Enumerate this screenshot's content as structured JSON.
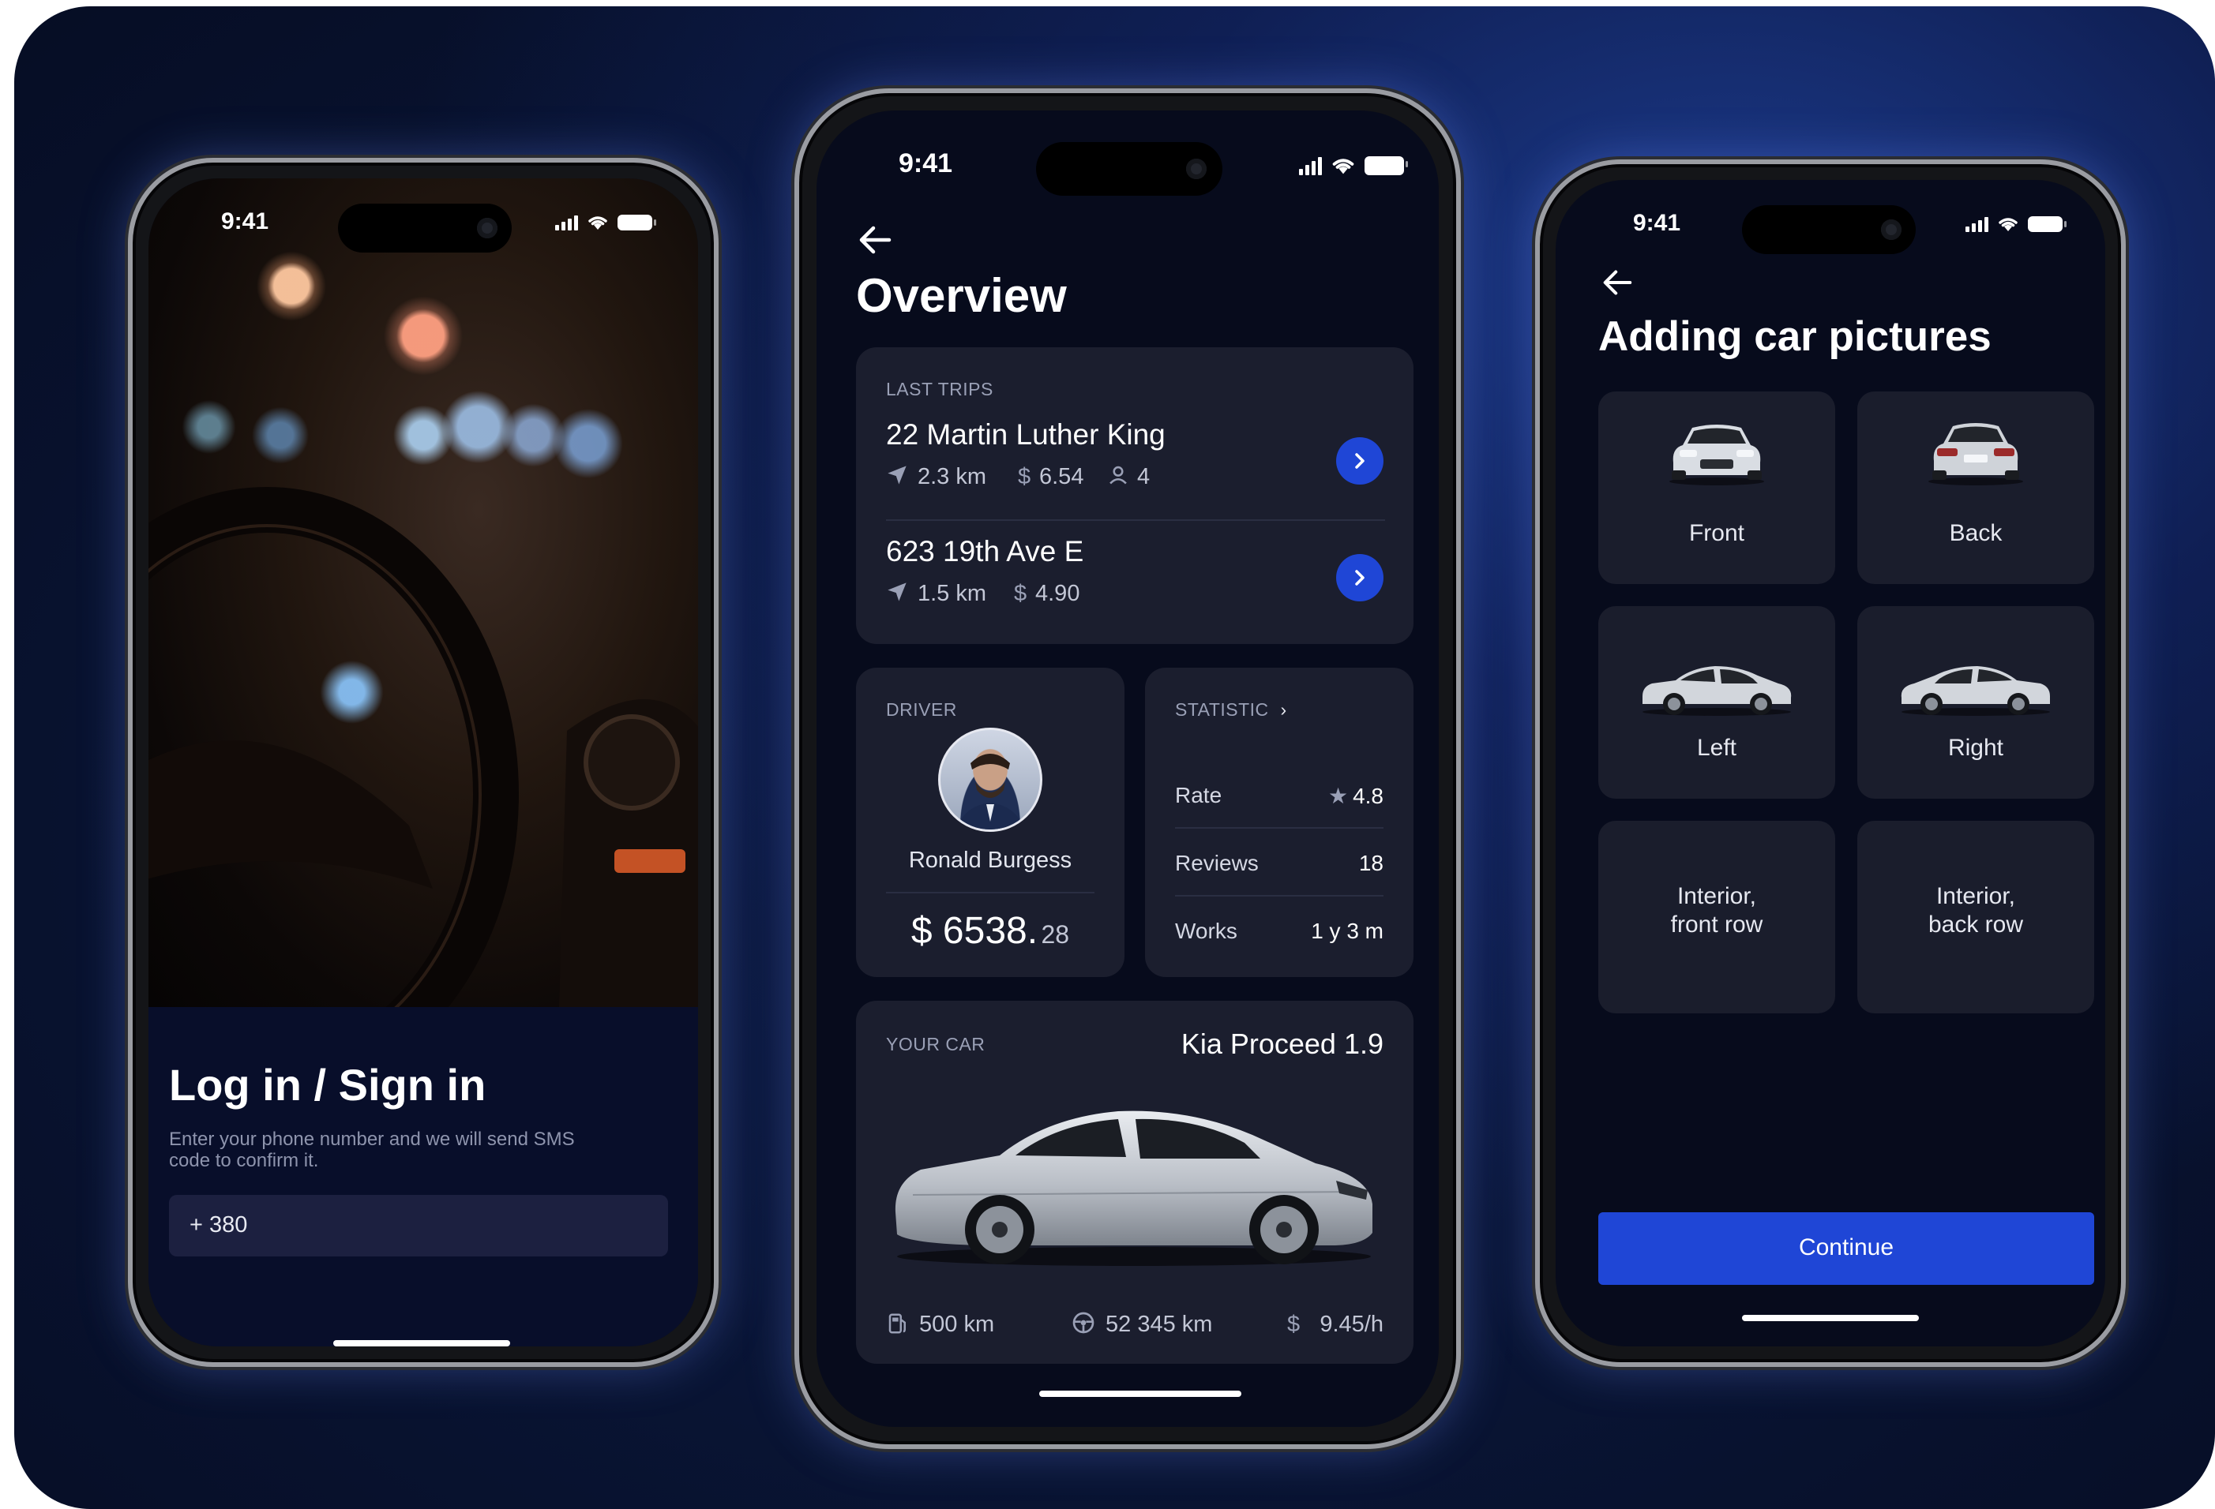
{
  "status_bar": {
    "time": "9:41"
  },
  "login_screen": {
    "title": "Log in / Sign in",
    "description": "Enter your phone number and we will send SMS code to confirm it.",
    "phone_input_value": "+ 380"
  },
  "overview_screen": {
    "title": "Overview",
    "last_trips": {
      "label": "LAST TRIPS",
      "trips": [
        {
          "address": "22 Martin Luther King",
          "distance": "2.3 km",
          "price": "6.54",
          "passengers": "4"
        },
        {
          "address": "623 19th Ave E",
          "distance": "1.5 km",
          "price": "4.90"
        }
      ]
    },
    "driver": {
      "label": "DRIVER",
      "name": "Ronald Burgess",
      "earnings_main": "$ 6538.",
      "earnings_cents": "28"
    },
    "statistic": {
      "label": "STATISTIC",
      "rows": [
        {
          "label": "Rate",
          "value": "4.8"
        },
        {
          "label": "Reviews",
          "value": "18"
        },
        {
          "label": "Works",
          "value": "1 y 3 m"
        }
      ]
    },
    "your_car": {
      "label": "YOUR CAR",
      "model": "Kia Proceed 1.9",
      "fuel_range": "500 km",
      "mileage": "52 345 km",
      "rate": "9.45/h"
    }
  },
  "car_pictures_screen": {
    "title": "Adding car pictures",
    "tiles": [
      "Front",
      "Back",
      "Left",
      "Right",
      "Interior,\nfront row",
      "Interior,\nback row"
    ],
    "continue_label": "Continue"
  },
  "colors": {
    "accent": "#1f46d6",
    "background": "#060b1d",
    "card": "#1b1e2e",
    "input": "#1c2040"
  }
}
